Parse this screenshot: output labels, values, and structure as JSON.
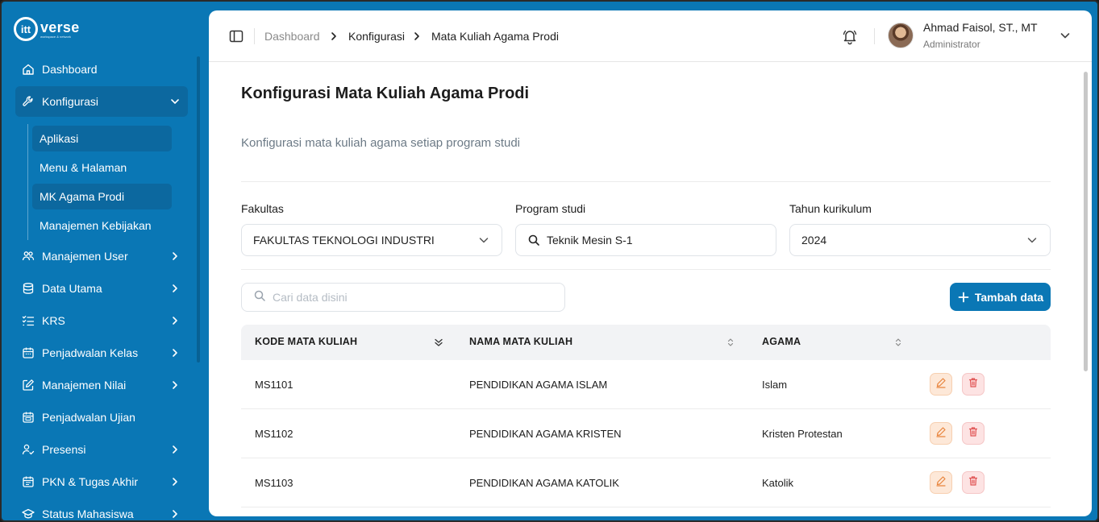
{
  "logo": {
    "mark": "itt",
    "name": "verse",
    "tagline": "workspace & network"
  },
  "sidebar": {
    "items": [
      {
        "label": "Dashboard",
        "icon": "home-icon",
        "has_children": false
      },
      {
        "label": "Konfigurasi",
        "icon": "wrench-icon",
        "has_children": true,
        "expanded": true
      },
      {
        "label": "Manajemen User",
        "icon": "users-icon",
        "has_children": true
      },
      {
        "label": "Data Utama",
        "icon": "database-icon",
        "has_children": true
      },
      {
        "label": "KRS",
        "icon": "list-check-icon",
        "has_children": true
      },
      {
        "label": "Penjadwalan Kelas",
        "icon": "calendar-icon",
        "has_children": true
      },
      {
        "label": "Manajemen Nilai",
        "icon": "edit-square-icon",
        "has_children": true
      },
      {
        "label": "Penjadwalan Ujian",
        "icon": "calendar-icon",
        "has_children": false
      },
      {
        "label": "Presensi",
        "icon": "user-check-icon",
        "has_children": true
      },
      {
        "label": "PKN & Tugas Akhir",
        "icon": "calendar-icon",
        "has_children": true
      },
      {
        "label": "Status Mahasiswa",
        "icon": "graduation-cap-icon",
        "has_children": true
      }
    ],
    "subitems": [
      {
        "label": "Aplikasi"
      },
      {
        "label": "Menu & Halaman"
      },
      {
        "label": "MK Agama Prodi"
      },
      {
        "label": "Manajemen Kebijakan"
      }
    ]
  },
  "topbar": {
    "breadcrumb": [
      "Dashboard",
      "Konfigurasi",
      "Mata Kuliah Agama Prodi"
    ],
    "user_name": "Ahmad Faisol, ST., MT",
    "user_role": "Administrator"
  },
  "page": {
    "title": "Konfigurasi Mata Kuliah Agama Prodi",
    "subtitle": "Konfigurasi mata kuliah agama setiap program studi"
  },
  "filters": {
    "fakultas_label": "Fakultas",
    "fakultas_value": "FAKULTAS TEKNOLOGI INDUSTRI",
    "prodi_label": "Program studi",
    "prodi_value": "Teknik Mesin S-1",
    "tahun_label": "Tahun kurikulum",
    "tahun_value": "2024"
  },
  "search": {
    "placeholder": "Cari data disini"
  },
  "add_button": {
    "label": "Tambah data"
  },
  "table": {
    "columns": [
      "KODE MATA KULIAH",
      "NAMA MATA KULIAH",
      "AGAMA"
    ],
    "rows": [
      [
        "MS1101",
        "PENDIDIKAN AGAMA ISLAM",
        "Islam"
      ],
      [
        "MS1102",
        "PENDIDIKAN AGAMA KRISTEN",
        "Kristen Protestan"
      ],
      [
        "MS1103",
        "PENDIDIKAN AGAMA KATOLIK",
        "Katolik"
      ]
    ]
  },
  "colors": {
    "brand": "#0a77b5",
    "active_item": "#0c689f",
    "edit": "#e8843c",
    "delete": "#e05252"
  }
}
